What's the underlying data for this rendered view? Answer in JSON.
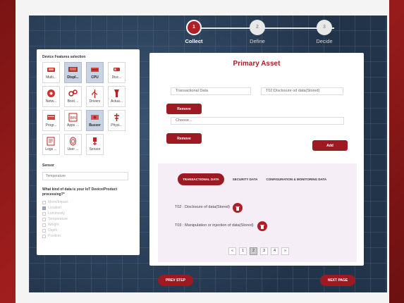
{
  "stepper": {
    "steps": [
      {
        "num": "1",
        "label": "Collect"
      },
      {
        "num": "2",
        "label": "Define"
      },
      {
        "num": "3",
        "label": "Decide"
      }
    ]
  },
  "left": {
    "title": "Device Features selection",
    "features": [
      {
        "label": "Multi...",
        "icon": "multimedia-icon"
      },
      {
        "label": "Displ...",
        "icon": "display-icon"
      },
      {
        "label": "CPU",
        "icon": "cpu-icon"
      },
      {
        "label": "Disc...",
        "icon": "disc-icon"
      },
      {
        "label": "Netw...",
        "icon": "network-icon"
      },
      {
        "label": "Boot ...",
        "icon": "boot-icon"
      },
      {
        "label": "Drivers",
        "icon": "usb-icon"
      },
      {
        "label": "Actua...",
        "icon": "actuator-icon"
      },
      {
        "label": "Progr...",
        "icon": "program-icon"
      },
      {
        "label": "Apps ...",
        "icon": "binary-icon"
      },
      {
        "label": "Buzzer",
        "icon": "buzzer-icon"
      },
      {
        "label": "Physi...",
        "icon": "physical-icon"
      },
      {
        "label": "Logs ...",
        "icon": "logs-icon"
      },
      {
        "label": "User ...",
        "icon": "fingerprint-icon"
      },
      {
        "label": "Sensor",
        "icon": "sensor-icon"
      }
    ],
    "sensor_title": "Sensor",
    "sensor_value": "Temperature",
    "question": "What kind of data is your IoT Device/Product processing?*",
    "options": [
      "Move/Impact",
      "Location",
      "Luminosity",
      "Temperature",
      "Weight",
      "Depth",
      "Position"
    ]
  },
  "main": {
    "title": "Primary Asset",
    "field1": "Transactional Data",
    "field2": "T02:Disclosure od data(Stored)",
    "remove_label": "Remove",
    "choose_placeholder": "Choose...",
    "add_label": "Add",
    "tabs": [
      "TRANSACTIONAL DATA",
      "SECURITY DATA",
      "CONFIGURATION & MONITORING DATA"
    ],
    "rows": [
      "T02 : Disclosure of data(Stored)",
      "T03 : Manipulation or injection of data(Stored)"
    ],
    "pager": [
      "«",
      "1",
      "2",
      "3",
      "4",
      "»"
    ],
    "prev_label": "PREV STEP",
    "next_label": "NEXT PAGE"
  },
  "colors": {
    "accent": "#9e1a22",
    "title": "#a31e28",
    "board": "#2c3f55"
  }
}
